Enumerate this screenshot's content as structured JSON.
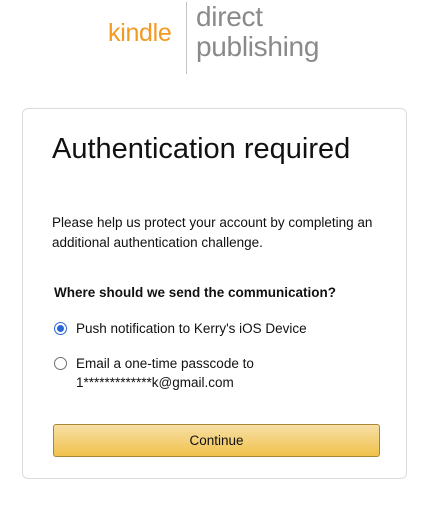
{
  "logo": {
    "kindle": "kindle",
    "direct": "direct",
    "publishing": "publishing"
  },
  "card": {
    "title": "Authentication required",
    "description": "Please help us protect your account by completing an additional authentication challenge.",
    "question": "Where should we send the communication?",
    "options": [
      {
        "label": "Push notification to Kerry's iOS Device",
        "selected": true
      },
      {
        "label": "Email a one-time passcode to 1*************k@gmail.com",
        "selected": false
      }
    ],
    "continue_label": "Continue"
  },
  "colors": {
    "kindle_orange": "#f29a22",
    "logo_gray": "#8a8a8a",
    "radio_blue": "#2b66d6",
    "button_gold": "#f0c14b"
  }
}
